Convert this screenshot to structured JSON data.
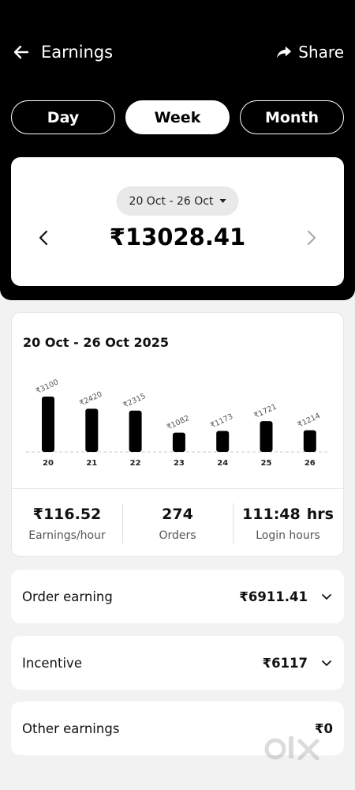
{
  "header": {
    "title": "Earnings",
    "share_label": "Share"
  },
  "tabs": [
    {
      "label": "Day",
      "active": false
    },
    {
      "label": "Week",
      "active": true
    },
    {
      "label": "Month",
      "active": false
    }
  ],
  "summary": {
    "range_label": "20 Oct - 26 Oct",
    "total": "₹13028.41"
  },
  "chart_card": {
    "title": "20 Oct - 26 Oct 2025"
  },
  "chart_data": {
    "type": "bar",
    "categories": [
      "20",
      "21",
      "22",
      "23",
      "24",
      "25",
      "26"
    ],
    "values": [
      3100,
      2420,
      2315,
      1082,
      1173,
      1721,
      1214
    ],
    "value_labels": [
      "₹3100",
      "₹2420",
      "₹2315",
      "₹1082",
      "₹1173",
      "₹1721",
      "₹1214"
    ],
    "bar_color": "#000000",
    "grid": false,
    "legend": "none"
  },
  "stats": [
    {
      "value": "₹116.52",
      "unit": "",
      "label": "Earnings/hour"
    },
    {
      "value": "274",
      "unit": "",
      "label": "Orders"
    },
    {
      "value": "111:48",
      "unit": "hrs",
      "label": "Login hours"
    }
  ],
  "rows": [
    {
      "label": "Order earning",
      "value": "₹6911.41",
      "expandable": true
    },
    {
      "label": "Incentive",
      "value": "₹6117",
      "expandable": true
    },
    {
      "label": "Other earnings",
      "value": "₹0",
      "expandable": false
    }
  ],
  "icons": [
    "arrow-left-icon",
    "share-icon",
    "chevron-left-icon",
    "chevron-right-icon",
    "chevron-down-icon",
    "caret-down-icon"
  ]
}
